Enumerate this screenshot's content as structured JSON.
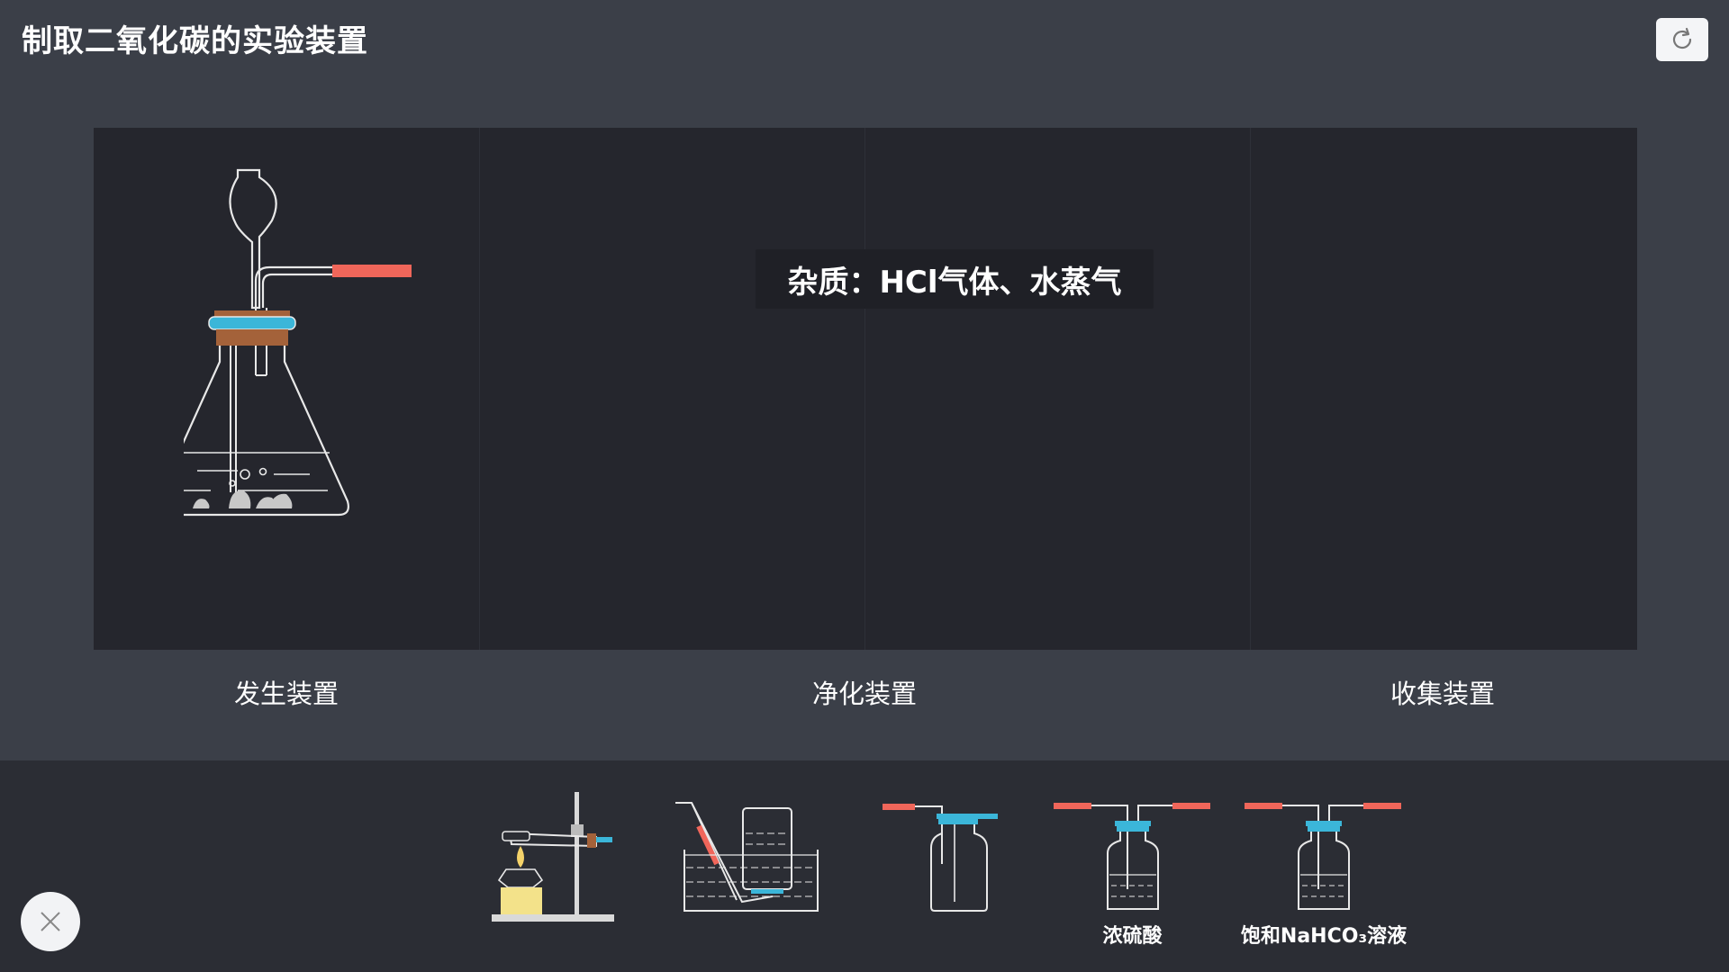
{
  "header": {
    "title": "制取二氧化碳的实验装置"
  },
  "stage": {
    "tooltip": "杂质：HCl气体、水蒸气",
    "slots": [
      "发生装置",
      "净化装置",
      "收集装置"
    ]
  },
  "tray": {
    "items": [
      {
        "name": "heating-apparatus",
        "label": ""
      },
      {
        "name": "water-collection",
        "label": ""
      },
      {
        "name": "gas-bottle",
        "label": ""
      },
      {
        "name": "wash-bottle-h2so4",
        "label": "浓硫酸"
      },
      {
        "name": "wash-bottle-nahco3",
        "label": "饱和NaHCO₃溶液"
      }
    ]
  },
  "colors": {
    "background": "#3b3f48",
    "stage": "#25262d",
    "tray": "#2b2d34",
    "accent_blue": "#3bb6d9",
    "accent_red": "#f0665a",
    "cork": "#a4623a"
  }
}
